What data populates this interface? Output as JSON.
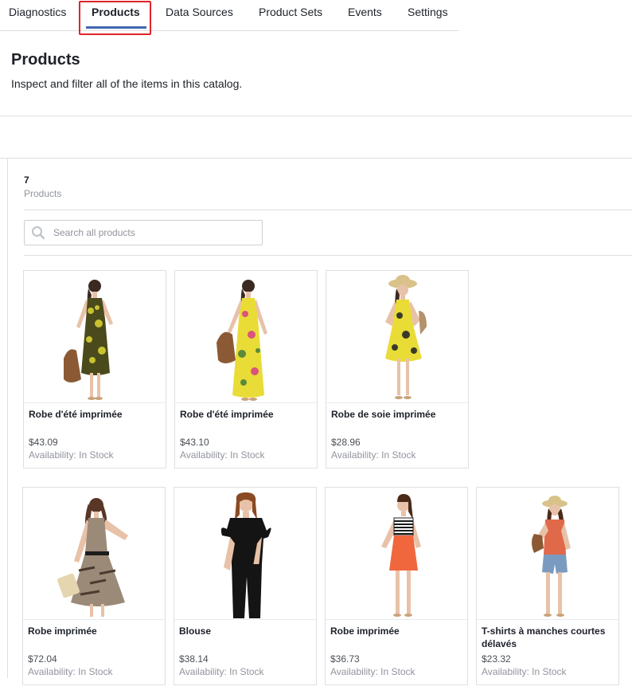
{
  "tabs": [
    {
      "label": "Diagnostics"
    },
    {
      "label": "Products"
    },
    {
      "label": "Data Sources"
    },
    {
      "label": "Product Sets"
    },
    {
      "label": "Events"
    },
    {
      "label": "Settings"
    }
  ],
  "header": {
    "title": "Products",
    "subtitle": "Inspect and filter all of the items in this catalog."
  },
  "summary": {
    "count": "7",
    "count_label": "Products"
  },
  "search": {
    "placeholder": "Search all products",
    "value": ""
  },
  "products": [
    {
      "name": "Robe d'été imprimée",
      "price": "$43.09",
      "availability": "Availability: In Stock"
    },
    {
      "name": "Robe d'été imprimée",
      "price": "$43.10",
      "availability": "Availability: In Stock"
    },
    {
      "name": "Robe de soie imprimée",
      "price": "$28.96",
      "availability": "Availability: In Stock"
    },
    {
      "name": "Robe imprimée",
      "price": "$72.04",
      "availability": "Availability: In Stock"
    },
    {
      "name": "Blouse",
      "price": "$38.14",
      "availability": "Availability: In Stock"
    },
    {
      "name": "Robe imprimée",
      "price": "$36.73",
      "availability": "Availability: In Stock"
    },
    {
      "name": "T-shirts à manches courtes délavés",
      "price": "$23.32",
      "availability": "Availability: In Stock"
    }
  ],
  "colors": {
    "accent": "#4267b2",
    "highlight": "#e0242a",
    "border": "#dddfe2",
    "muted_text": "#90949c"
  }
}
